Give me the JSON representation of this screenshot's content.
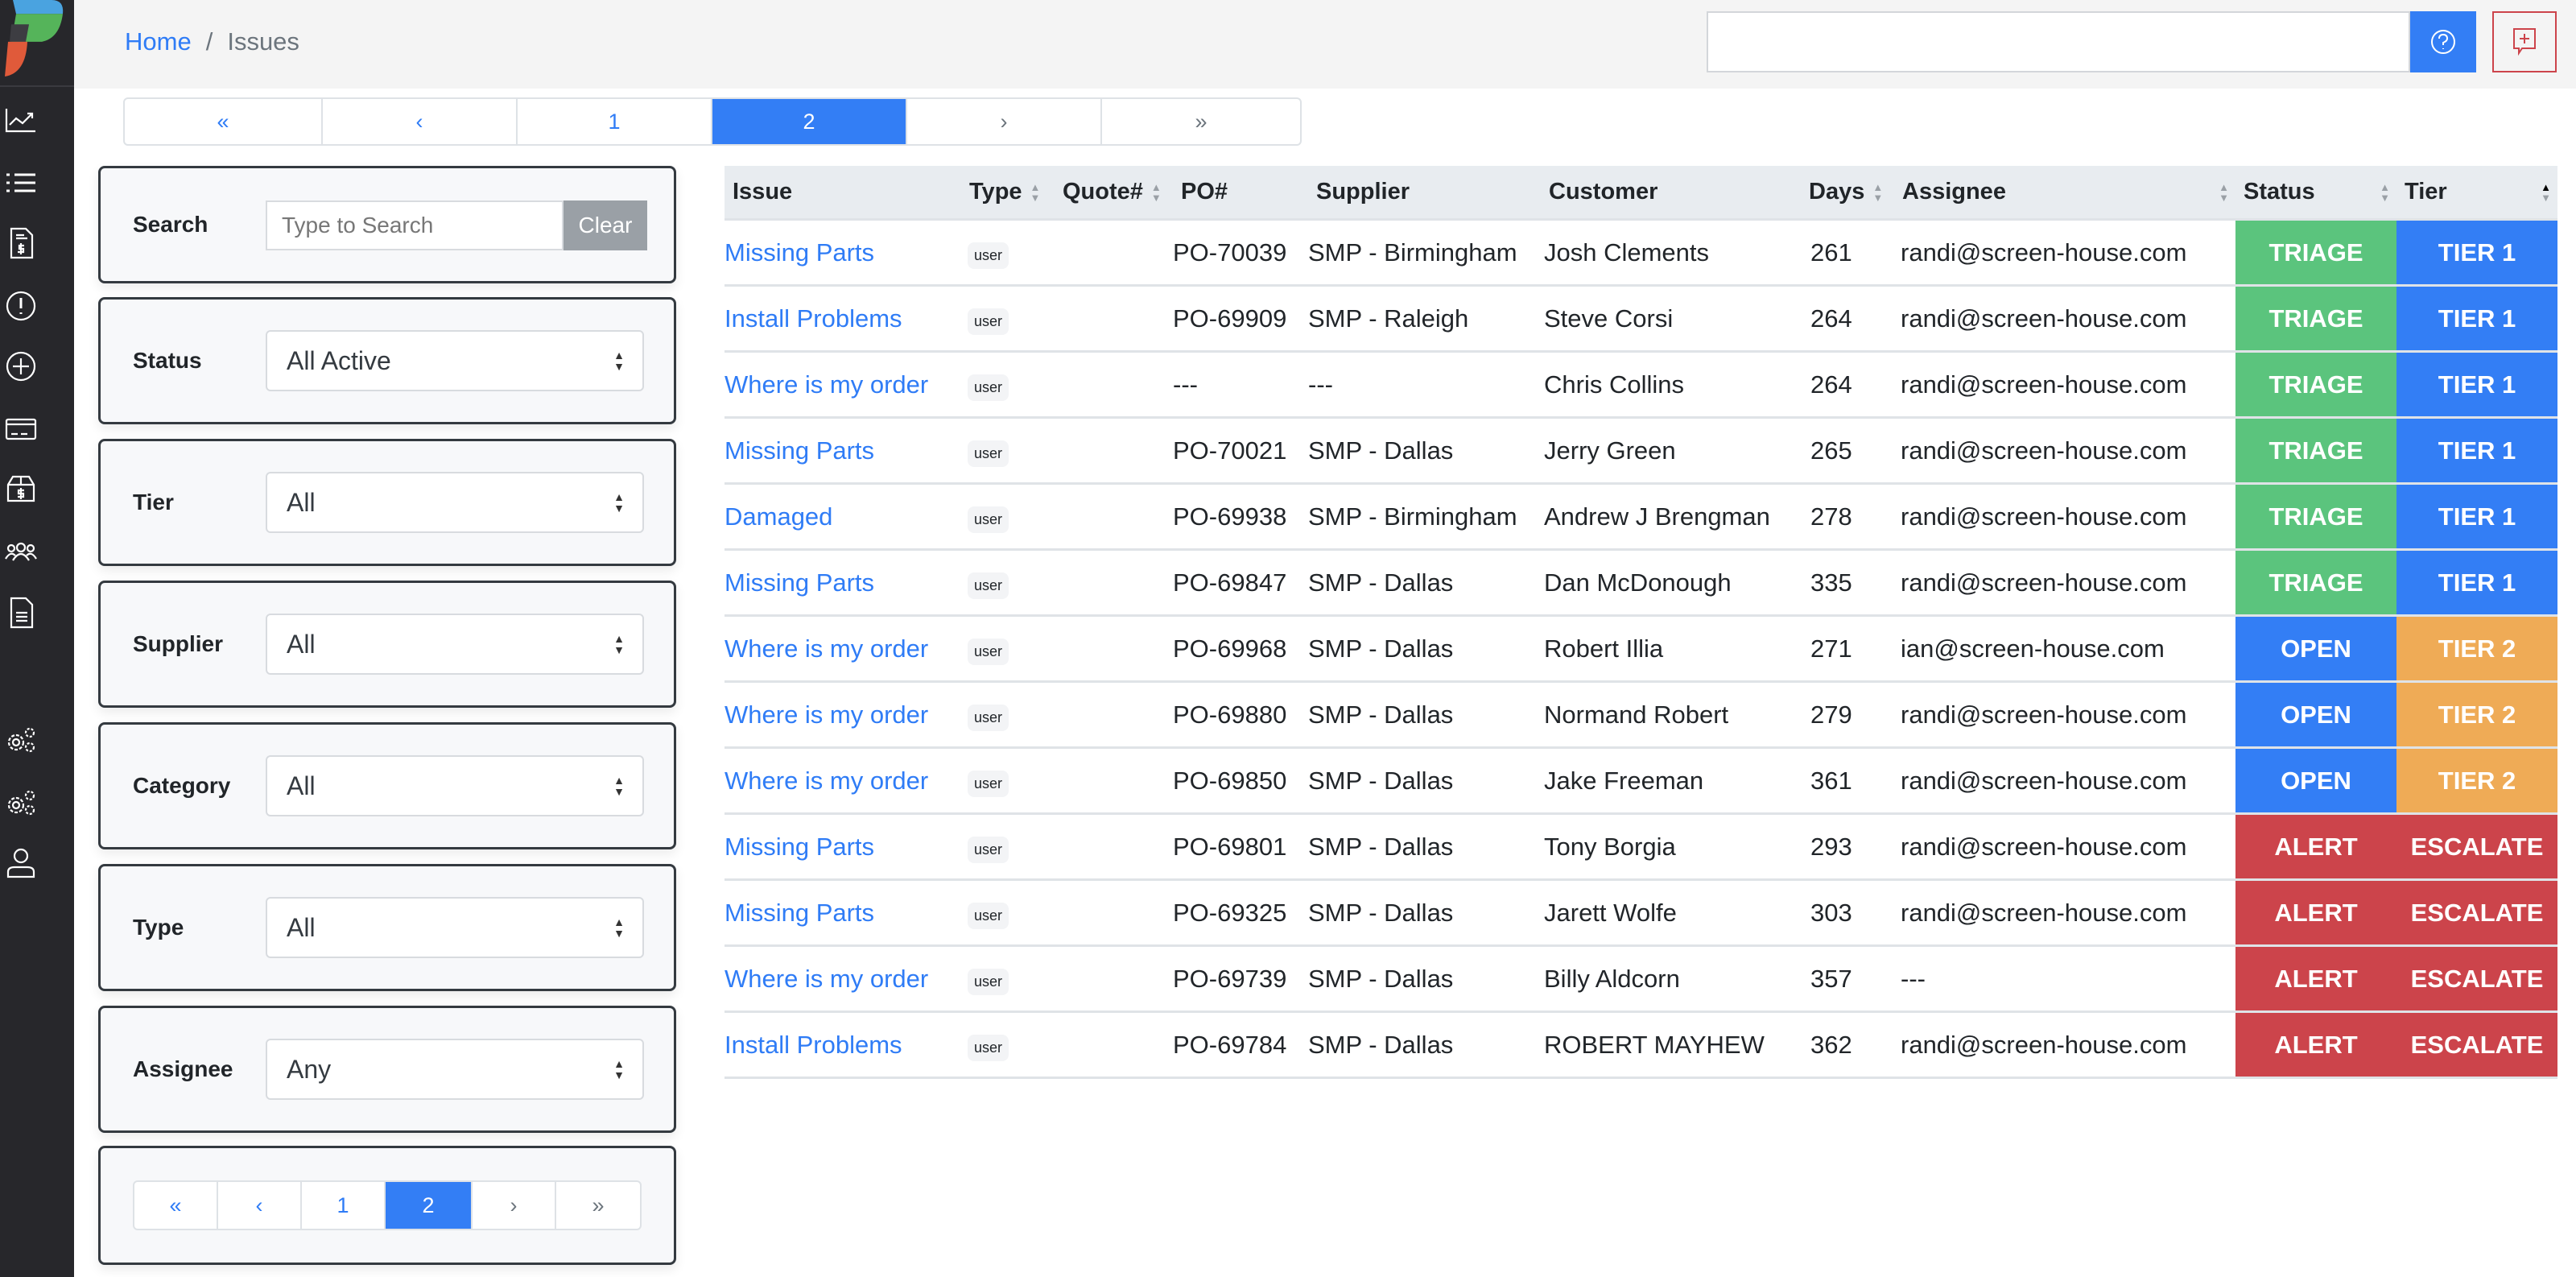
{
  "breadcrumb": {
    "home": "Home",
    "separator": "/",
    "current": "Issues"
  },
  "header": {
    "search_value": "",
    "help_icon": "question-circle-icon",
    "feedback_icon": "chat-plus-icon"
  },
  "colors": {
    "primary": "#337ef5",
    "triage": "#5bc47d",
    "open": "#337ef5",
    "alert": "#cc444b",
    "tier1": "#337ef5",
    "tier2": "#efab56",
    "escalate": "#cc444b"
  },
  "sidebar": {
    "items": [
      "chart-line-icon",
      "list-icon",
      "invoice-dollar-icon",
      "alert-circle-icon",
      "plus-circle-icon",
      "credit-card-icon",
      "box-dollar-icon",
      "users-icon",
      "document-icon",
      "gears-icon",
      "gears-icon",
      "user-icon"
    ]
  },
  "pagination": {
    "first": "«",
    "prev": "‹",
    "pages": [
      "1",
      "2"
    ],
    "current": "2",
    "next": "›",
    "last": "»"
  },
  "filters": {
    "search": {
      "label": "Search",
      "placeholder": "Type to Search",
      "clear": "Clear"
    },
    "status": {
      "label": "Status",
      "value": "All Active"
    },
    "tier": {
      "label": "Tier",
      "value": "All"
    },
    "supplier": {
      "label": "Supplier",
      "value": "All"
    },
    "category": {
      "label": "Category",
      "value": "All"
    },
    "type": {
      "label": "Type",
      "value": "All"
    },
    "assignee": {
      "label": "Assignee",
      "value": "Any"
    }
  },
  "table": {
    "columns": [
      "Issue",
      "Type",
      "Quote#",
      "PO#",
      "Supplier",
      "Customer",
      "Days",
      "Assignee",
      "Status",
      "Tier"
    ],
    "sort": {
      "column": "Tier",
      "direction": "ascending"
    },
    "rows": [
      {
        "issue": "Missing Parts",
        "type": "user",
        "quote": "",
        "po": "PO-70039",
        "supplier": "SMP - Birmingham",
        "customer": "Josh Clements",
        "days": "261",
        "assignee": "randi@screen-house.com",
        "status": "TRIAGE",
        "tier": "TIER 1"
      },
      {
        "issue": "Install Problems",
        "type": "user",
        "quote": "",
        "po": "PO-69909",
        "supplier": "SMP - Raleigh",
        "customer": "Steve Corsi",
        "days": "264",
        "assignee": "randi@screen-house.com",
        "status": "TRIAGE",
        "tier": "TIER 1"
      },
      {
        "issue": "Where is my order",
        "type": "user",
        "quote": "",
        "po": "---",
        "supplier": "---",
        "customer": "Chris Collins",
        "days": "264",
        "assignee": "randi@screen-house.com",
        "status": "TRIAGE",
        "tier": "TIER 1"
      },
      {
        "issue": "Missing Parts",
        "type": "user",
        "quote": "",
        "po": "PO-70021",
        "supplier": "SMP - Dallas",
        "customer": "Jerry Green",
        "days": "265",
        "assignee": "randi@screen-house.com",
        "status": "TRIAGE",
        "tier": "TIER 1"
      },
      {
        "issue": "Damaged",
        "type": "user",
        "quote": "",
        "po": "PO-69938",
        "supplier": "SMP - Birmingham",
        "customer": "Andrew J Brengman",
        "days": "278",
        "assignee": "randi@screen-house.com",
        "status": "TRIAGE",
        "tier": "TIER 1"
      },
      {
        "issue": "Missing Parts",
        "type": "user",
        "quote": "",
        "po": "PO-69847",
        "supplier": "SMP - Dallas",
        "customer": "Dan McDonough",
        "days": "335",
        "assignee": "randi@screen-house.com",
        "status": "TRIAGE",
        "tier": "TIER 1"
      },
      {
        "issue": "Where is my order",
        "type": "user",
        "quote": "",
        "po": "PO-69968",
        "supplier": "SMP - Dallas",
        "customer": "Robert Illia",
        "days": "271",
        "assignee": "ian@screen-house.com",
        "status": "OPEN",
        "tier": "TIER 2"
      },
      {
        "issue": "Where is my order",
        "type": "user",
        "quote": "",
        "po": "PO-69880",
        "supplier": "SMP - Dallas",
        "customer": "Normand Robert",
        "days": "279",
        "assignee": "randi@screen-house.com",
        "status": "OPEN",
        "tier": "TIER 2"
      },
      {
        "issue": "Where is my order",
        "type": "user",
        "quote": "",
        "po": "PO-69850",
        "supplier": "SMP - Dallas",
        "customer": "Jake Freeman",
        "days": "361",
        "assignee": "randi@screen-house.com",
        "status": "OPEN",
        "tier": "TIER 2"
      },
      {
        "issue": "Missing Parts",
        "type": "user",
        "quote": "",
        "po": "PO-69801",
        "supplier": "SMP - Dallas",
        "customer": "Tony Borgia",
        "days": "293",
        "assignee": "randi@screen-house.com",
        "status": "ALERT",
        "tier": "ESCALATE"
      },
      {
        "issue": "Missing Parts",
        "type": "user",
        "quote": "",
        "po": "PO-69325",
        "supplier": "SMP - Dallas",
        "customer": "Jarett Wolfe",
        "days": "303",
        "assignee": "randi@screen-house.com",
        "status": "ALERT",
        "tier": "ESCALATE"
      },
      {
        "issue": "Where is my order",
        "type": "user",
        "quote": "",
        "po": "PO-69739",
        "supplier": "SMP - Dallas",
        "customer": "Billy Aldcorn",
        "days": "357",
        "assignee": "---",
        "status": "ALERT",
        "tier": "ESCALATE"
      },
      {
        "issue": "Install Problems",
        "type": "user",
        "quote": "",
        "po": "PO-69784",
        "supplier": "SMP - Dallas",
        "customer": "ROBERT MAYHEW",
        "days": "362",
        "assignee": "randi@screen-house.com",
        "status": "ALERT",
        "tier": "ESCALATE"
      }
    ]
  }
}
